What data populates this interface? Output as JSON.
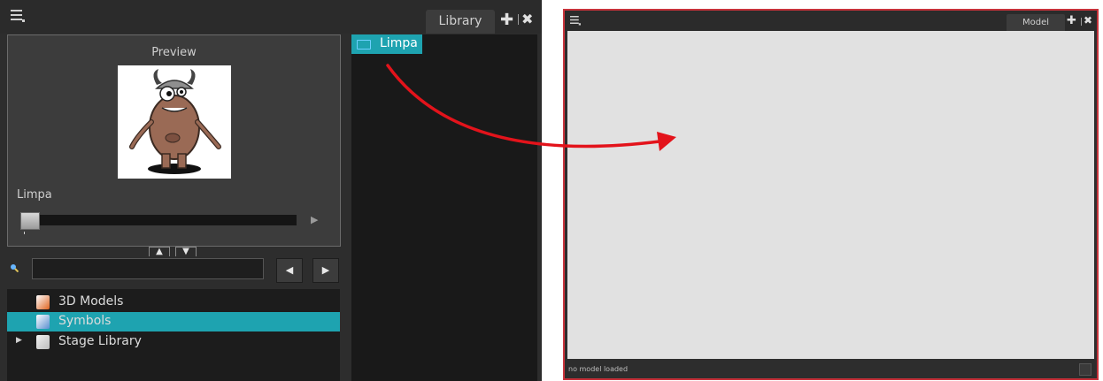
{
  "library_window": {
    "tab_label": "Library",
    "preview": {
      "title": "Preview",
      "item_name": "Limpa",
      "play_icon": "▶"
    },
    "search": {
      "value": "",
      "placeholder": ""
    },
    "nav": {
      "prev": "◀",
      "next": "▶"
    },
    "collapse": {
      "up": "▲",
      "down": "▼"
    },
    "tree": [
      {
        "label": "3D Models",
        "icon": "orange-box-icon",
        "selected": false
      },
      {
        "label": "Symbols",
        "icon": "blue-box-icon",
        "selected": true
      },
      {
        "label": "Stage Library",
        "icon": "locked-folder-icon",
        "selected": false,
        "expandable": true
      }
    ],
    "contents": [
      {
        "label": "Limpa",
        "icon": "template-icon",
        "selected": true
      }
    ]
  },
  "model_window": {
    "tab_label": "Model",
    "status": "no model loaded"
  },
  "colors": {
    "selection": "#1ea3b0",
    "arrow": "#e3131b",
    "model_border": "#c7333b",
    "panel_bg": "#2d2d2d"
  }
}
